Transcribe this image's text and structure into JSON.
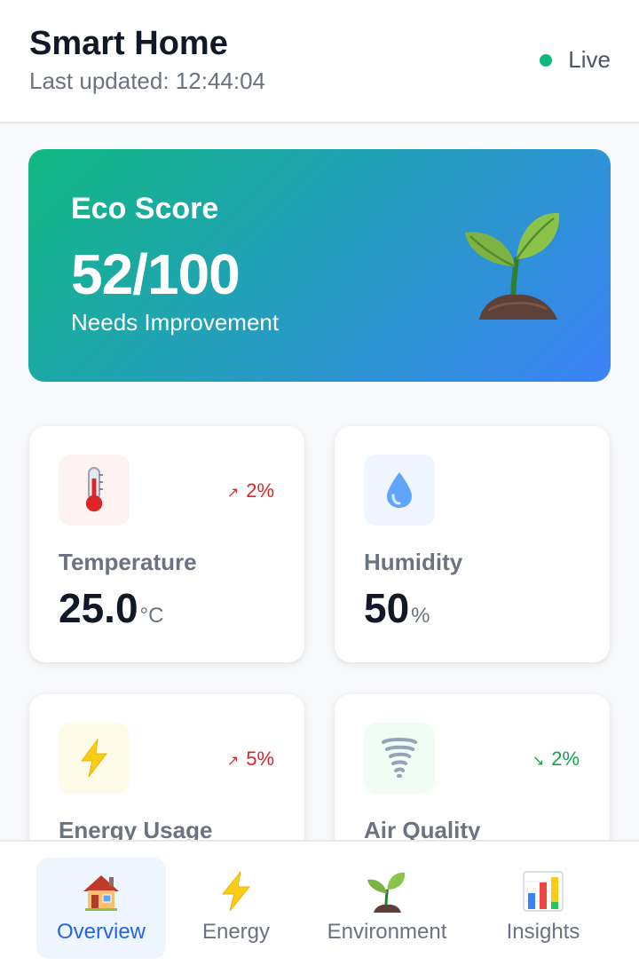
{
  "header": {
    "title": "Smart Home",
    "last_updated": "Last updated: 12:44:04",
    "status": "Live"
  },
  "eco_score": {
    "title": "Eco Score",
    "score": "52/100",
    "status": "Needs Improvement",
    "icon": "seedling-icon"
  },
  "cards": [
    {
      "label": "Temperature",
      "value": "25.0",
      "unit": "°C",
      "trend": "2%",
      "trend_direction": "up",
      "icon": "thermometer-icon",
      "icon_bg": "#fef2f2"
    },
    {
      "label": "Humidity",
      "value": "50",
      "unit": "%",
      "icon": "droplet-icon",
      "icon_bg": "#eff6ff"
    },
    {
      "label": "Energy Usage",
      "trend": "5%",
      "trend_direction": "up",
      "icon": "lightning-icon",
      "icon_bg": "#fefce8"
    },
    {
      "label": "Air Quality",
      "trend": "2%",
      "trend_direction": "down",
      "icon": "tornado-icon",
      "icon_bg": "#f0fdf4"
    }
  ],
  "nav": {
    "items": [
      {
        "label": "Overview",
        "icon": "house-icon",
        "active": true
      },
      {
        "label": "Energy",
        "icon": "lightning-icon"
      },
      {
        "label": "Environment",
        "icon": "seedling-icon"
      },
      {
        "label": "Insights",
        "icon": "bar-chart-icon"
      }
    ]
  },
  "colors": {
    "live": "#10b981",
    "accent": "#2563eb",
    "trend_up": "#dc2626",
    "trend_down": "#16a34a",
    "eco_gradient_start": "#10b981",
    "eco_gradient_end": "#3b82f6"
  }
}
